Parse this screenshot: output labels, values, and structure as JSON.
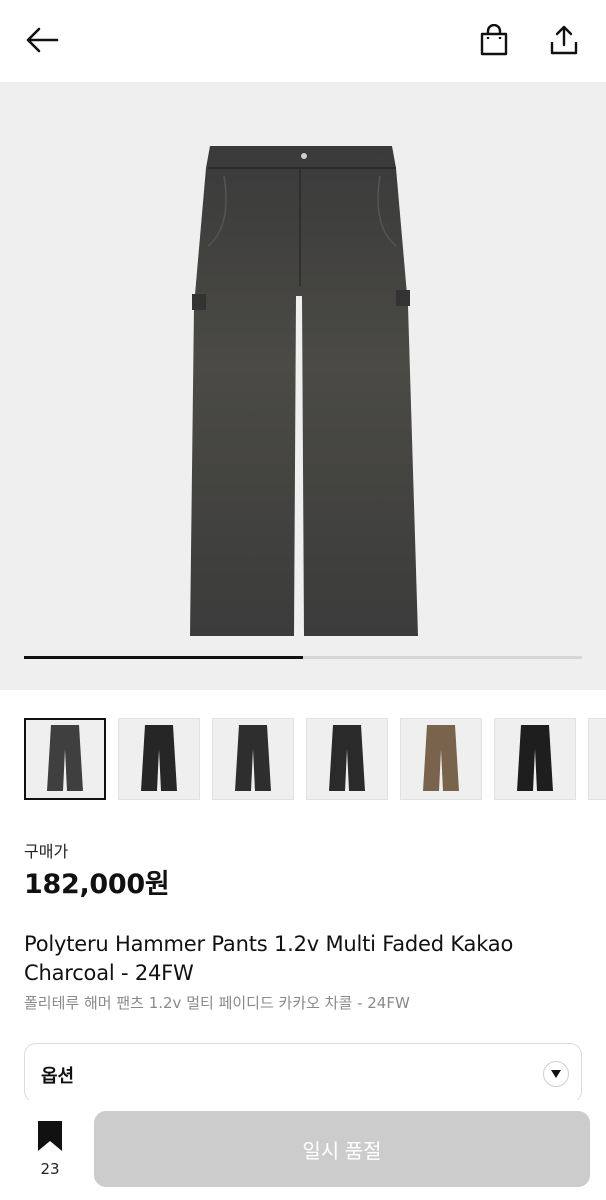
{
  "header": {
    "back_icon": "arrow-left-icon",
    "bag_icon": "shopping-bag-icon",
    "share_icon": "share-upload-icon"
  },
  "gallery": {
    "progress": 0.5,
    "image_color": "#4a4a4a",
    "thumbnails": [
      {
        "color": "#3f3f3f",
        "selected": true
      },
      {
        "color": "#262626",
        "selected": false
      },
      {
        "color": "#2e2e2e",
        "selected": false
      },
      {
        "color": "#2a2a2a",
        "selected": false
      },
      {
        "color": "#7a634c",
        "selected": false
      },
      {
        "color": "#1e1e1e",
        "selected": false
      }
    ]
  },
  "price": {
    "label": "구매가",
    "value": "182,000원"
  },
  "product": {
    "title": "Polyteru Hammer Pants 1.2v Multi Faded Kakao Charcoal - 24FW",
    "subtitle": "폴리테루 해머 팬츠 1.2v 멀티 페이디드 카카오 차콜 - 24FW"
  },
  "option": {
    "label": "옵션",
    "caret_icon": "caret-down-icon"
  },
  "bottom": {
    "bookmark_count": "23",
    "bookmark_icon": "bookmark-icon",
    "button_label": "일시 품절"
  }
}
